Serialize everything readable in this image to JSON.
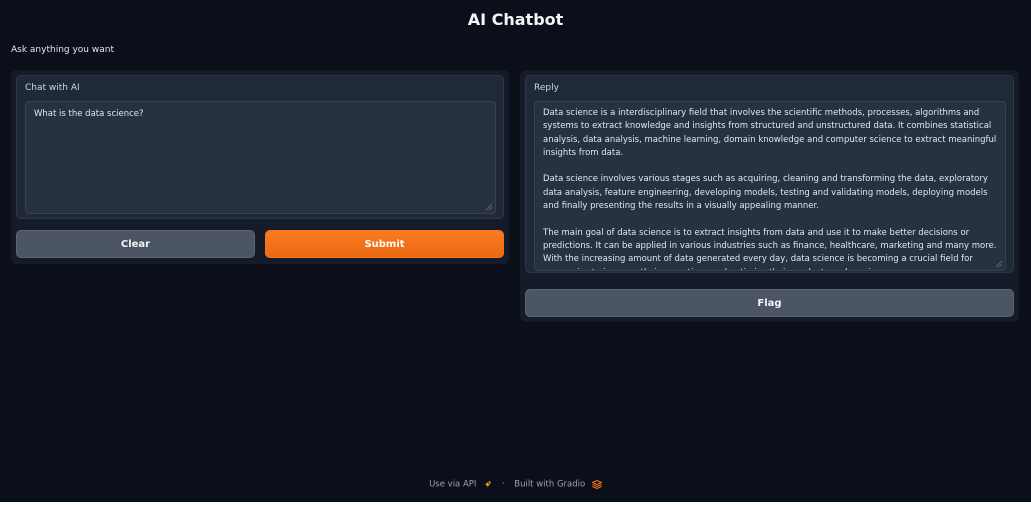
{
  "app": {
    "title": "AI Chatbot",
    "subtitle": "Ask anything you want"
  },
  "input_panel": {
    "label": "Chat with AI",
    "value": "What is the data science?",
    "clear_label": "Clear",
    "submit_label": "Submit"
  },
  "output_panel": {
    "label": "Reply",
    "paragraphs": [
      "Data science is a interdisciplinary field that involves the scientific methods, processes, algorithms and systems to extract knowledge and insights from structured and unstructured data. It combines statistical analysis, data analysis, machine learning, domain knowledge and computer science to extract meaningful insights from data.",
      "Data science involves various stages such as acquiring, cleaning and transforming the data, exploratory data analysis, feature engineering, developing models, testing and validating models, deploying models and finally presenting the results in a visually appealing manner.",
      "The main goal of data science is to extract insights from data and use it to make better decisions or predictions. It can be applied in various industries such as finance, healthcare, marketing and many more. With the increasing amount of data generated every day, data science is becoming a crucial field for companies to improve their operations and optimize their products and services."
    ],
    "flag_label": "Flag"
  },
  "footer": {
    "api_label": "Use via API",
    "separator": "·",
    "built_label": "Built with Gradio",
    "api_icon": "rocket-icon",
    "gradio_icon": "gradio-logo-icon"
  },
  "colors": {
    "background": "#0b0f19",
    "panel": "#151b28",
    "accent": "#f97316",
    "secondary_button": "#4b5563"
  }
}
